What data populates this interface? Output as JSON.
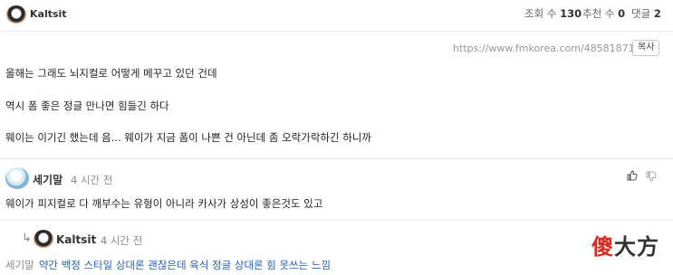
{
  "post": {
    "author": "Kaltsit",
    "views_label": "조회 수",
    "views": "130",
    "likes_label": "추천 수",
    "likes": "0",
    "comments_label": "댓글",
    "comments": "2",
    "url": "https://www.fmkorea.com/4858187162",
    "copy_label": "복사",
    "lines": [
      "올해는 그래도 뇌지컬로 어떻게 메꾸고 있던 건데",
      "역시 폼 좋은 정글 만나면 힘들긴 하다",
      "웨이는 이기긴 했는데 음... 웨이가 지금 폼이 나쁜 건 아닌데 좀 오락가락하긴 하니까"
    ]
  },
  "comment": {
    "author": "세기말",
    "time": "4 시간 전",
    "text": "웨이가 피지컬로 다 깨부수는 유형이 아니라 카사가 상성이 좋은것도 있고",
    "like_icon": "thumbs-up-icon",
    "dislike_icon": "thumbs-down-icon"
  },
  "reply": {
    "author": "Kaltsit",
    "time": "4 시간 전",
    "prefix": "세기말",
    "text": "약간 백정 스타일 상대론 괜찮은데 육식 정글 상대론 힘 못쓰는 느낌"
  },
  "watermark": {
    "char1": "傻",
    "rest": "大方"
  }
}
